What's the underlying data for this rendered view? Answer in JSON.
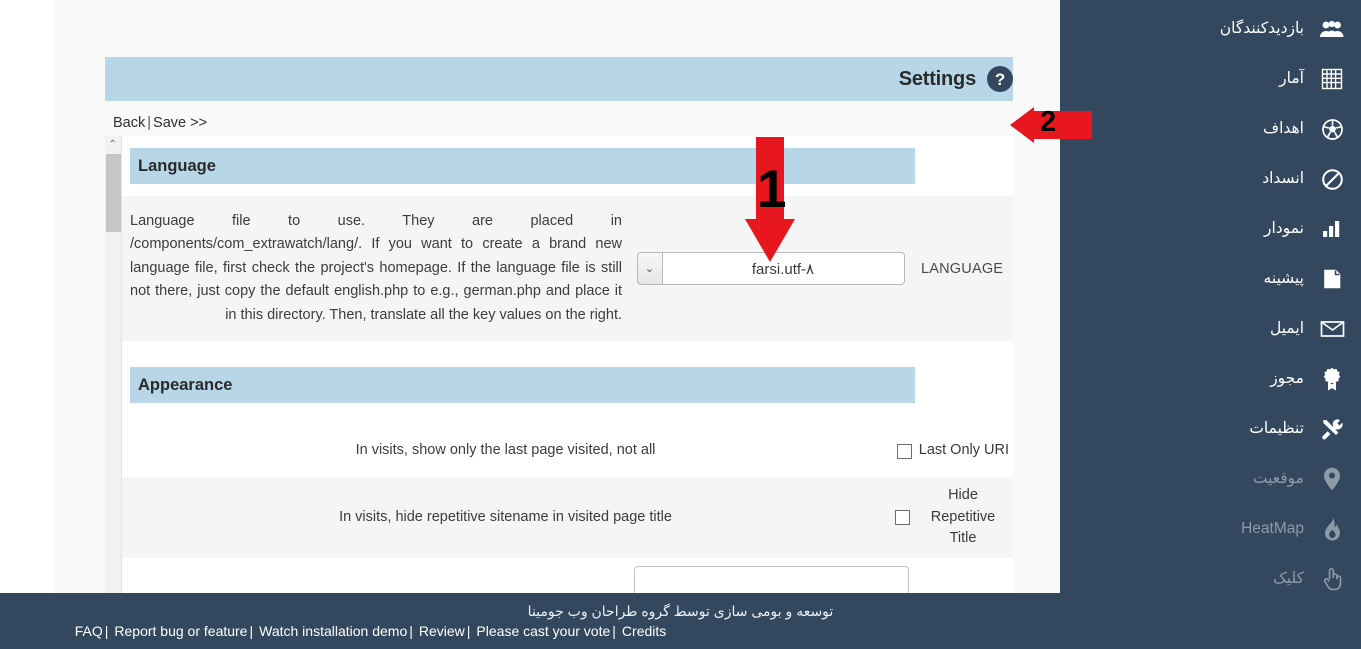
{
  "sidebar": {
    "items": [
      {
        "label": "بازدیدکنندگان",
        "icon": "users-icon",
        "dim": false
      },
      {
        "label": "آمار",
        "icon": "grid-stats-icon",
        "dim": false
      },
      {
        "label": "اهداف",
        "icon": "goal-ball-icon",
        "dim": false
      },
      {
        "label": "انسداد",
        "icon": "block-icon",
        "dim": false
      },
      {
        "label": "نمودار",
        "icon": "bar-chart-icon",
        "dim": false
      },
      {
        "label": "پیشینه",
        "icon": "book-icon",
        "dim": false
      },
      {
        "label": "ایمیل",
        "icon": "envelope-icon",
        "dim": false
      },
      {
        "label": "مجوز",
        "icon": "award-ribbon-icon",
        "dim": false
      },
      {
        "label": "تنظیمات",
        "icon": "tools-icon",
        "dim": false
      },
      {
        "label": "موقعیت",
        "icon": "map-pin-icon",
        "dim": true
      },
      {
        "label": "HeatMap",
        "icon": "flame-icon",
        "dim": true
      },
      {
        "label": "کلیک",
        "icon": "pointing-hand-icon",
        "dim": true
      }
    ]
  },
  "header": {
    "title": "Settings",
    "help_icon_label": "?"
  },
  "toolbar": {
    "back_label": "Back",
    "separator": "|",
    "save_label": "Save >>"
  },
  "scrollbar": {
    "up_arrow": "⌃"
  },
  "sections": {
    "language": {
      "title": "Language",
      "field_label": "LANGUAGE",
      "selected_value": "farsi.utf-۸",
      "dropdown_icon": "⌄",
      "description": "Language file to use. They are placed in /components/com_extrawatch/lang/. If you want to create a brand new language file, first check the project's homepage. If the language file is still not there, just copy the default english.php to e.g., german.php and place it in this directory. Then, translate all the key values on the right."
    },
    "appearance": {
      "title": "Appearance",
      "rows": [
        {
          "label": "Last Only URI",
          "description": "In visits, show only the last page visited, not all",
          "checked": false
        },
        {
          "label": "Hide Repetitive Title",
          "description": "In visits, hide repetitive sitename in visited page title",
          "checked": false
        }
      ]
    }
  },
  "footer": {
    "credit_fa": "توسعه و بومی سازی توسط گروه طراحان وب جومینا",
    "links": [
      "FAQ",
      "Report bug or feature",
      "Watch installation demo",
      "Review",
      "Please cast your vote",
      "Credits"
    ],
    "link_separator": "|"
  },
  "annotations": {
    "marker_one": "1",
    "marker_two": "2"
  },
  "colors": {
    "sidebar_bg": "#33485e",
    "band_blue": "#b7d7e8",
    "annotation_red": "#e8161f",
    "page_bg": "#f9f9f9"
  }
}
